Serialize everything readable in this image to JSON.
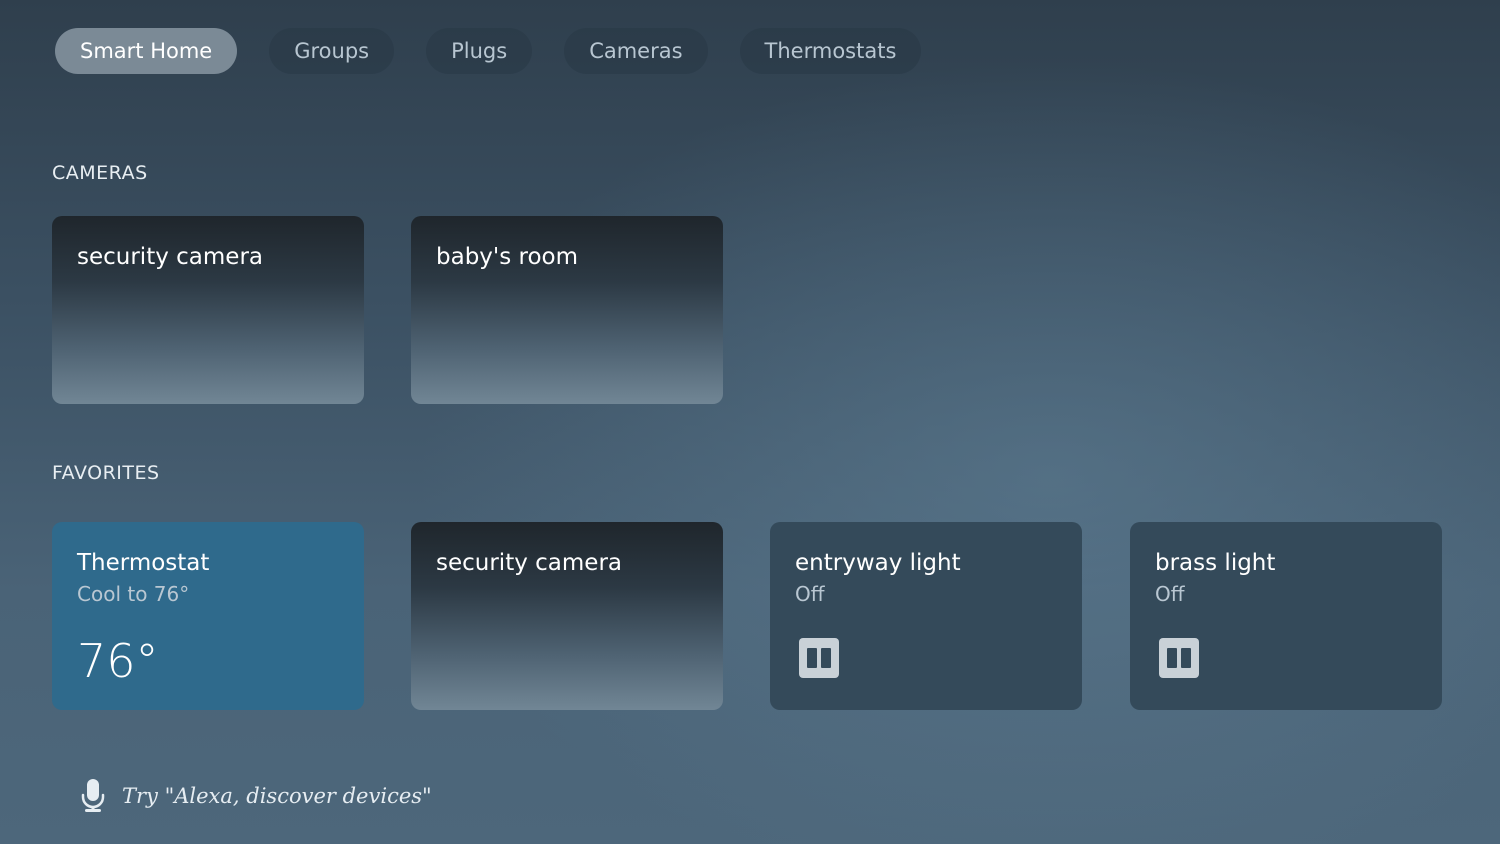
{
  "nav": {
    "tabs": [
      {
        "label": "Smart Home",
        "active": true
      },
      {
        "label": "Groups",
        "active": false
      },
      {
        "label": "Plugs",
        "active": false
      },
      {
        "label": "Cameras",
        "active": false
      },
      {
        "label": "Thermostats",
        "active": false
      }
    ]
  },
  "cameras": {
    "title": "CAMERAS",
    "items": [
      {
        "name": "security camera"
      },
      {
        "name": "baby's room"
      }
    ]
  },
  "favorites": {
    "title": "FAVORITES",
    "thermostat": {
      "name": "Thermostat",
      "status": "Cool to 76°",
      "temperature": "76°"
    },
    "camera": {
      "name": "security camera"
    },
    "lights": [
      {
        "name": "entryway light",
        "status": "Off",
        "icon": "light-switch-icon"
      },
      {
        "name": "brass light",
        "status": "Off",
        "icon": "light-switch-icon"
      }
    ]
  },
  "hint": {
    "icon": "microphone-icon",
    "text": "Try \"Alexa, discover devices\""
  },
  "colors": {
    "active_tab": "#7b8a96",
    "thermostat_card": "#2f6a8c",
    "light_card": "#344a5a"
  }
}
